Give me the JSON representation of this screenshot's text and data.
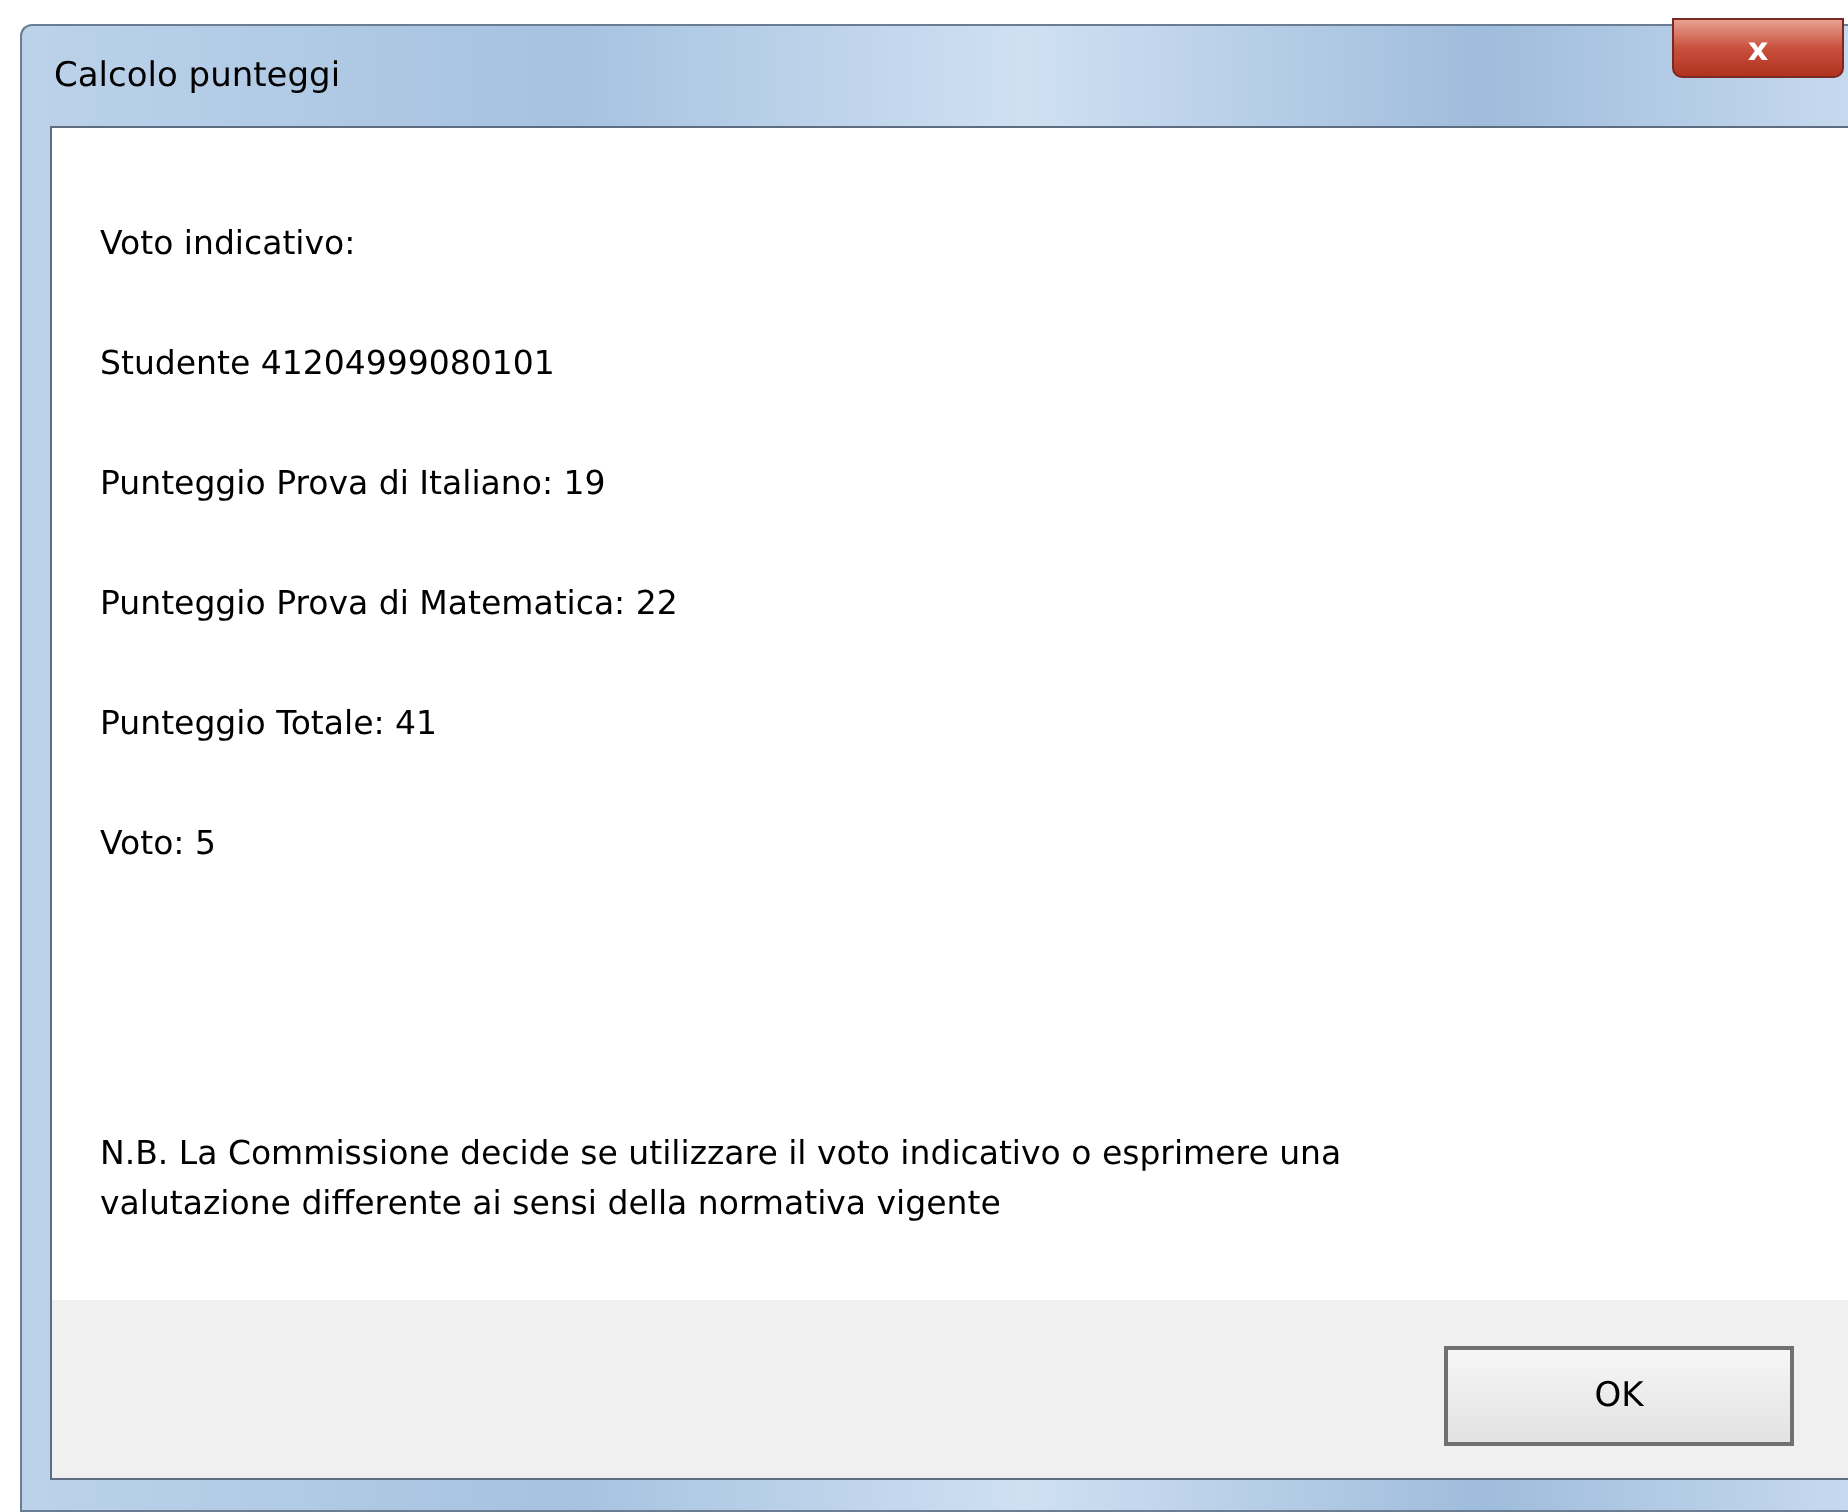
{
  "window": {
    "title": "Calcolo punteggi",
    "close_label": "x"
  },
  "lines": [
    "Voto indicativo:",
    "Studente 41204999080101",
    "Punteggio Prova di Italiano: 19",
    "Punteggio Prova di Matematica: 22",
    "Punteggio Totale: 41",
    "Voto: 5"
  ],
  "note": "N.B. La Commissione decide se utilizzare il voto indicativo o esprimere una valutazione differente ai sensi della normativa vigente",
  "buttons": [
    "OK"
  ]
}
